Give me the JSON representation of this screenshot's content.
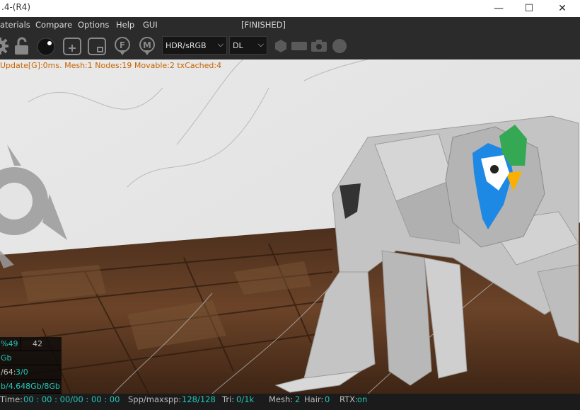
{
  "window": {
    "title": ".4-(R4)",
    "minimize_glyph": "—",
    "maximize_glyph": "☐",
    "close_glyph": "✕"
  },
  "menu": {
    "items": [
      "aterials",
      "Compare",
      "Options",
      "Help",
      "GUI"
    ],
    "render_state": "[FINISHED]"
  },
  "toolbar": {
    "icons": [
      "gear-icon",
      "unlock-icon",
      "sphere-icon",
      "add-node-icon",
      "node-icon",
      "f-pin-icon",
      "m-pin-icon"
    ],
    "tonemap_select": "HDR/sRGB",
    "kernel_select": "DL",
    "chevron": "⌵",
    "extra_icons": [
      "hexagon-icon",
      "rectangle-icon",
      "camera-icon",
      "circle-icon"
    ]
  },
  "viewport": {
    "status_line": "Update[G]:0ms. Mesh:1 Nodes:19 Movable:2 txCached:4"
  },
  "stats_panel": {
    "row1_a": "%49",
    "row1_b": "42",
    "row2": "Gb",
    "row3_label": "/64:",
    "row3_value": "3/0",
    "row4": "b/4.648Gb/8Gb"
  },
  "bottom_status": {
    "time_label": "Time:",
    "time_value": "00 : 00 : 00/00 : 00 : 00",
    "spp_label": "Spp/maxspp:",
    "spp_value": "128/128",
    "tri_label": "Tri:",
    "tri_value": "0/1k",
    "mesh_label": "Mesh:",
    "mesh_value": "2",
    "hair_label": "Hair:",
    "hair_value": "0",
    "rtx_label": "RTX:",
    "rtx_value": "on"
  },
  "colors": {
    "toolbar_bg": "#2b2b2b",
    "status_orange": "#c86400",
    "value_cyan": "#22c7b8",
    "parrot_blue": "#1e88e5",
    "parrot_green": "#34a853",
    "parrot_yellow": "#f9b000"
  }
}
